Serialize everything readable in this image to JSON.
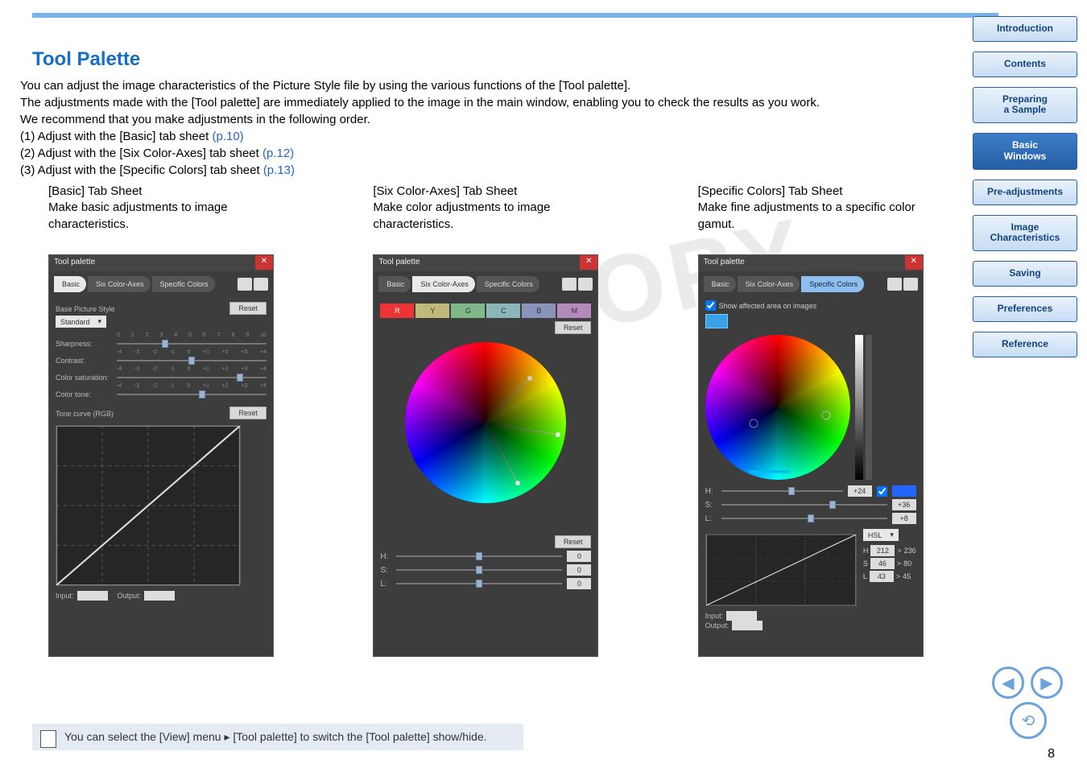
{
  "page": {
    "title": "Tool Palette",
    "number": "8",
    "intro_lines": [
      "You can adjust the image characteristics of the Picture Style file by using the various functions of the [Tool palette].",
      "The adjustments made with the [Tool palette] are immediately applied to the image in the main window, enabling you to check the results as you work.",
      "We recommend that you make adjustments in the following order."
    ],
    "steps": {
      "s1_prefix": "(1) Adjust with the [Basic] tab sheet ",
      "s1_link": "(p.10)",
      "s2_prefix": "(2) Adjust with the [Six Color-Axes] tab sheet ",
      "s2_link": "(p.12)",
      "s3_prefix": "(3) Adjust with the [Specific Colors] tab sheet ",
      "s3_link": "(p.13)"
    },
    "watermark": "COPY"
  },
  "columns": {
    "basic": {
      "title": "[Basic] Tab Sheet",
      "desc": "Make basic adjustments to image characteristics."
    },
    "six": {
      "title": "[Six Color-Axes] Tab Sheet",
      "desc": "Make color adjustments to image characteristics."
    },
    "spec": {
      "title": "[Specific Colors] Tab Sheet",
      "desc": "Make fine adjustments to a specific color gamut."
    }
  },
  "palette": {
    "window_title": "Tool palette",
    "tabs": {
      "basic": "Basic",
      "six": "Six Color-Axes",
      "spec": "Specific Colors"
    },
    "base_ps_label": "Base Picture Style",
    "base_ps_value": "Standard",
    "reset": "Reset",
    "sliders": {
      "sharpness": "Sharpness:",
      "contrast": "Contrast:",
      "colsat": "Color saturation:",
      "coltone": "Color tone:"
    },
    "tone_curve_label": "Tone curve (RGB)",
    "io": {
      "input": "Input:",
      "output": "Output:"
    },
    "rygcbm": {
      "r": "R",
      "y": "Y",
      "g": "G",
      "c": "C",
      "b": "B",
      "m": "M"
    },
    "hsl": {
      "h": "H:",
      "s": "S:",
      "l": "L:",
      "hv": "0",
      "sv": "0",
      "lv": "0"
    },
    "spec": {
      "show_affected": "Show affected area on images",
      "h_val": "+24",
      "s_val": "+36",
      "l_val": "+8",
      "mode": "HSL",
      "h_pair_a": "212",
      "h_pair_b": "236",
      "s_pair_a": "46",
      "s_pair_b": "80",
      "l_pair_a": "43",
      "l_pair_b": "45",
      "row_h": "H",
      "row_s": "S",
      "row_l": "L",
      "arrow": ">"
    }
  },
  "footnote": {
    "prefix": "You can select the [View] menu ",
    "arrow": "▸",
    "mid": " [Tool palette] to switch the [Tool palette] show/hide."
  },
  "sidenav": {
    "introduction": "Introduction",
    "contents": "Contents",
    "preparing": "Preparing\na Sample",
    "basic_windows": "Basic\nWindows",
    "preadj": "Pre-adjustments",
    "imgchar": "Image\nCharacteristics",
    "saving": "Saving",
    "prefs": "Preferences",
    "reference": "Reference"
  }
}
